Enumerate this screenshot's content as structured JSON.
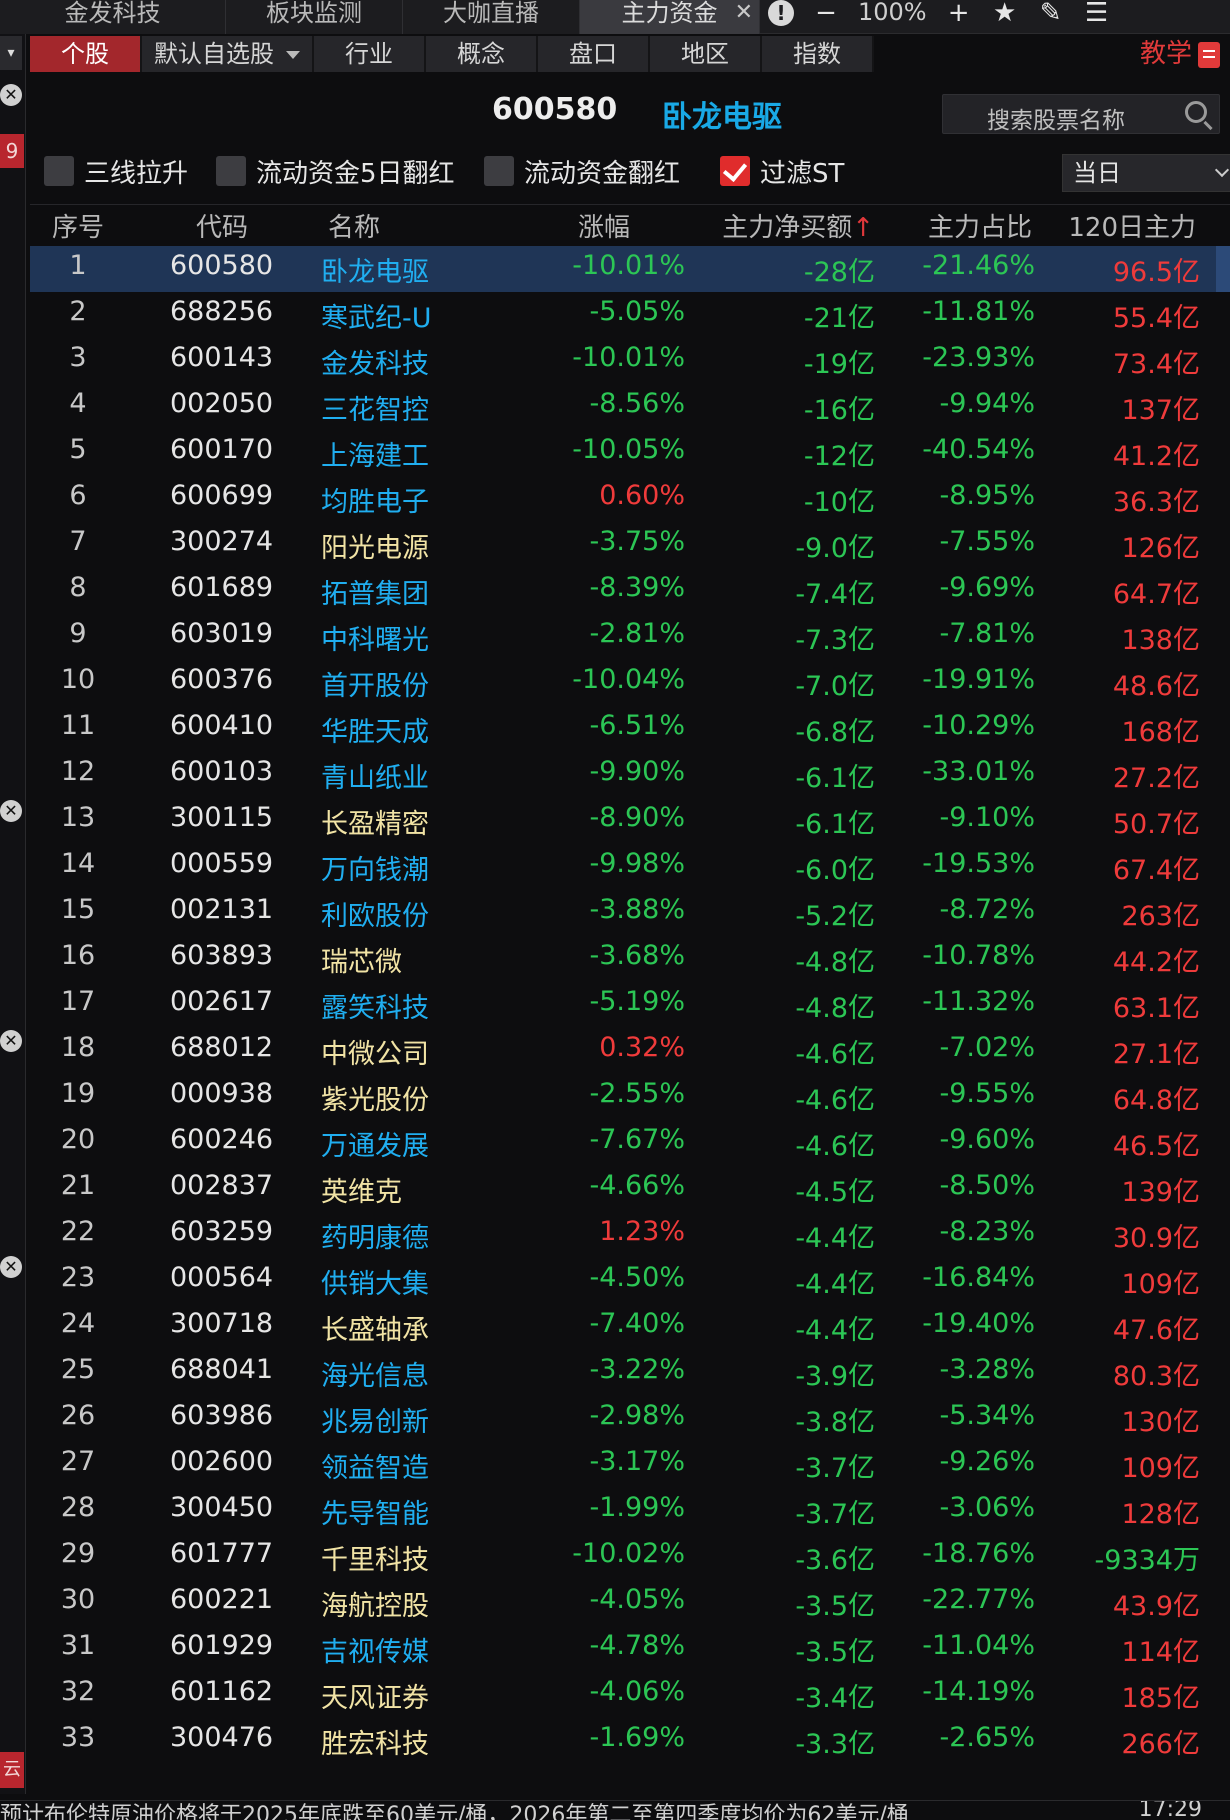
{
  "top_tabs": [
    {
      "label": "金发科技",
      "active": false
    },
    {
      "label": "板块监测",
      "active": false
    },
    {
      "label": "大咖直播",
      "active": false
    },
    {
      "label": "主力资金",
      "active": true
    }
  ],
  "top_controls": {
    "zoom": "100%"
  },
  "left_strip": {
    "value": "9",
    "bottom_label": "云"
  },
  "nav_tabs": [
    "个股",
    "默认自选股",
    "行业",
    "概念",
    "盘口",
    "地区",
    "指数"
  ],
  "teach_label": "教学",
  "stock": {
    "code": "600580",
    "name": "卧龙电驱"
  },
  "search": {
    "placeholder": "搜索股票名称"
  },
  "filters": [
    {
      "label": "三线拉升",
      "checked": false
    },
    {
      "label": "流动资金5日翻红",
      "checked": false
    },
    {
      "label": "流动资金翻红",
      "checked": false
    },
    {
      "label": "过滤ST",
      "checked": true
    }
  ],
  "period": "当日",
  "columns": {
    "idx": "序号",
    "code": "代码",
    "name": "名称",
    "chg": "涨幅",
    "net": "主力净买额",
    "net_sort": "↑",
    "pct": "主力占比",
    "d120": "120日主力"
  },
  "rows": [
    {
      "idx": "1",
      "code": "600580",
      "name": "卧龙电驱",
      "name_color": "blue",
      "chg": "-10.01%",
      "net": "-28亿",
      "pct": "-21.46%",
      "d120": "96.5亿"
    },
    {
      "idx": "2",
      "code": "688256",
      "name": "寒武纪-U",
      "name_color": "blue",
      "chg": "-5.05%",
      "net": "-21亿",
      "pct": "-11.81%",
      "d120": "55.4亿"
    },
    {
      "idx": "3",
      "code": "600143",
      "name": "金发科技",
      "name_color": "blue",
      "chg": "-10.01%",
      "net": "-19亿",
      "pct": "-23.93%",
      "d120": "73.4亿"
    },
    {
      "idx": "4",
      "code": "002050",
      "name": "三花智控",
      "name_color": "blue",
      "chg": "-8.56%",
      "net": "-16亿",
      "pct": "-9.94%",
      "d120": "137亿"
    },
    {
      "idx": "5",
      "code": "600170",
      "name": "上海建工",
      "name_color": "blue",
      "chg": "-10.05%",
      "net": "-12亿",
      "pct": "-40.54%",
      "d120": "41.2亿"
    },
    {
      "idx": "6",
      "code": "600699",
      "name": "均胜电子",
      "name_color": "blue",
      "chg": "0.60%",
      "net": "-10亿",
      "pct": "-8.95%",
      "d120": "36.3亿"
    },
    {
      "idx": "7",
      "code": "300274",
      "name": "阳光电源",
      "name_color": "yellow",
      "chg": "-3.75%",
      "net": "-9.0亿",
      "pct": "-7.55%",
      "d120": "126亿"
    },
    {
      "idx": "8",
      "code": "601689",
      "name": "拓普集团",
      "name_color": "blue",
      "chg": "-8.39%",
      "net": "-7.4亿",
      "pct": "-9.69%",
      "d120": "64.7亿"
    },
    {
      "idx": "9",
      "code": "603019",
      "name": "中科曙光",
      "name_color": "blue",
      "chg": "-2.81%",
      "net": "-7.3亿",
      "pct": "-7.81%",
      "d120": "138亿"
    },
    {
      "idx": "10",
      "code": "600376",
      "name": "首开股份",
      "name_color": "blue",
      "chg": "-10.04%",
      "net": "-7.0亿",
      "pct": "-19.91%",
      "d120": "48.6亿"
    },
    {
      "idx": "11",
      "code": "600410",
      "name": "华胜天成",
      "name_color": "blue",
      "chg": "-6.51%",
      "net": "-6.8亿",
      "pct": "-10.29%",
      "d120": "168亿"
    },
    {
      "idx": "12",
      "code": "600103",
      "name": "青山纸业",
      "name_color": "blue",
      "chg": "-9.90%",
      "net": "-6.1亿",
      "pct": "-33.01%",
      "d120": "27.2亿"
    },
    {
      "idx": "13",
      "code": "300115",
      "name": "长盈精密",
      "name_color": "yellow",
      "chg": "-8.90%",
      "net": "-6.1亿",
      "pct": "-9.10%",
      "d120": "50.7亿"
    },
    {
      "idx": "14",
      "code": "000559",
      "name": "万向钱潮",
      "name_color": "blue",
      "chg": "-9.98%",
      "net": "-6.0亿",
      "pct": "-19.53%",
      "d120": "67.4亿"
    },
    {
      "idx": "15",
      "code": "002131",
      "name": "利欧股份",
      "name_color": "blue",
      "chg": "-3.88%",
      "net": "-5.2亿",
      "pct": "-8.72%",
      "d120": "263亿"
    },
    {
      "idx": "16",
      "code": "603893",
      "name": "瑞芯微",
      "name_color": "yellow",
      "chg": "-3.68%",
      "net": "-4.8亿",
      "pct": "-10.78%",
      "d120": "44.2亿"
    },
    {
      "idx": "17",
      "code": "002617",
      "name": "露笑科技",
      "name_color": "blue",
      "chg": "-5.19%",
      "net": "-4.8亿",
      "pct": "-11.32%",
      "d120": "63.1亿"
    },
    {
      "idx": "18",
      "code": "688012",
      "name": "中微公司",
      "name_color": "yellow",
      "chg": "0.32%",
      "net": "-4.6亿",
      "pct": "-7.02%",
      "d120": "27.1亿"
    },
    {
      "idx": "19",
      "code": "000938",
      "name": "紫光股份",
      "name_color": "yellow",
      "chg": "-2.55%",
      "net": "-4.6亿",
      "pct": "-9.55%",
      "d120": "64.8亿"
    },
    {
      "idx": "20",
      "code": "600246",
      "name": "万通发展",
      "name_color": "blue",
      "chg": "-7.67%",
      "net": "-4.6亿",
      "pct": "-9.60%",
      "d120": "46.5亿"
    },
    {
      "idx": "21",
      "code": "002837",
      "name": "英维克",
      "name_color": "yellow",
      "chg": "-4.66%",
      "net": "-4.5亿",
      "pct": "-8.50%",
      "d120": "139亿"
    },
    {
      "idx": "22",
      "code": "603259",
      "name": "药明康德",
      "name_color": "blue",
      "chg": "1.23%",
      "net": "-4.4亿",
      "pct": "-8.23%",
      "d120": "30.9亿"
    },
    {
      "idx": "23",
      "code": "000564",
      "name": "供销大集",
      "name_color": "blue",
      "chg": "-4.50%",
      "net": "-4.4亿",
      "pct": "-16.84%",
      "d120": "109亿"
    },
    {
      "idx": "24",
      "code": "300718",
      "name": "长盛轴承",
      "name_color": "yellow",
      "chg": "-7.40%",
      "net": "-4.4亿",
      "pct": "-19.40%",
      "d120": "47.6亿"
    },
    {
      "idx": "25",
      "code": "688041",
      "name": "海光信息",
      "name_color": "blue",
      "chg": "-3.22%",
      "net": "-3.9亿",
      "pct": "-3.28%",
      "d120": "80.3亿"
    },
    {
      "idx": "26",
      "code": "603986",
      "name": "兆易创新",
      "name_color": "blue",
      "chg": "-2.98%",
      "net": "-3.8亿",
      "pct": "-5.34%",
      "d120": "130亿"
    },
    {
      "idx": "27",
      "code": "002600",
      "name": "领益智造",
      "name_color": "blue",
      "chg": "-3.17%",
      "net": "-3.7亿",
      "pct": "-9.26%",
      "d120": "109亿"
    },
    {
      "idx": "28",
      "code": "300450",
      "name": "先导智能",
      "name_color": "blue",
      "chg": "-1.99%",
      "net": "-3.7亿",
      "pct": "-3.06%",
      "d120": "128亿"
    },
    {
      "idx": "29",
      "code": "601777",
      "name": "千里科技",
      "name_color": "yellow",
      "chg": "-10.02%",
      "net": "-3.6亿",
      "pct": "-18.76%",
      "d120": "-9334万"
    },
    {
      "idx": "30",
      "code": "600221",
      "name": "海航控股",
      "name_color": "yellow",
      "chg": "-4.05%",
      "net": "-3.5亿",
      "pct": "-22.77%",
      "d120": "43.9亿"
    },
    {
      "idx": "31",
      "code": "601929",
      "name": "吉视传媒",
      "name_color": "blue",
      "chg": "-4.78%",
      "net": "-3.5亿",
      "pct": "-11.04%",
      "d120": "114亿"
    },
    {
      "idx": "32",
      "code": "601162",
      "name": "天风证券",
      "name_color": "yellow",
      "chg": "-4.06%",
      "net": "-3.4亿",
      "pct": "-14.19%",
      "d120": "185亿"
    },
    {
      "idx": "33",
      "code": "300476",
      "name": "胜宏科技",
      "name_color": "yellow",
      "chg": "-1.69%",
      "net": "-3.3亿",
      "pct": "-2.65%",
      "d120": "266亿"
    }
  ],
  "ticker": {
    "text": "预计布伦特原油价格将于2025年底跌至60美元/桶，2026年第二至第四季度均价为62美元/桶",
    "time": "17:29"
  },
  "colors": {
    "accent": "#a3272c",
    "up": "#ef3b3b",
    "down": "#2cc655",
    "link": "#20aef0",
    "selected_row": "#1f3556"
  }
}
